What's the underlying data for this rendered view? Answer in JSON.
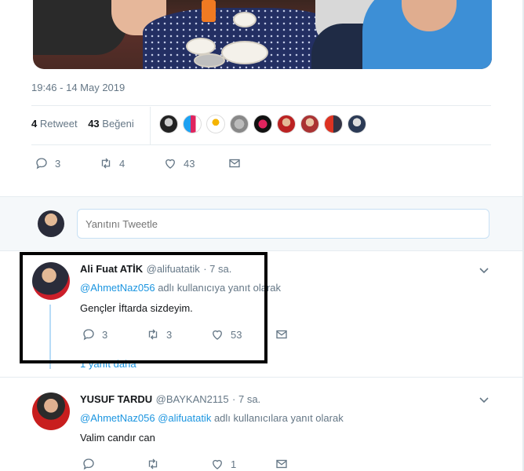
{
  "tweet": {
    "timestamp": "19:46 - 14 May 2019",
    "retweets": {
      "count": "4",
      "label": "Retweet"
    },
    "likes": {
      "count": "43",
      "label": "Beğeni"
    },
    "actions": {
      "reply_count": "3",
      "retweet_count": "4",
      "like_count": "43"
    }
  },
  "reply_box": {
    "placeholder": "Yanıtını Tweetle"
  },
  "replies": [
    {
      "name": "Ali Fuat ATİK",
      "handle": "@alifuatatik",
      "time": "· 7 sa.",
      "replying_to": [
        "@AhmetNaz056"
      ],
      "replying_text": "adlı kullanıcıya yanıt olarak",
      "text": "Gençler İftarda sizdeyim.",
      "reply_count": "3",
      "retweet_count": "3",
      "like_count": "53",
      "more_replies": "1 yanıt daha"
    },
    {
      "name": "YUSUF TARDU",
      "handle": "@BAYKAN2115",
      "time": "· 7 sa.",
      "replying_to": [
        "@AhmetNaz056",
        "@alifuatatik"
      ],
      "replying_text": "adlı kullanıcılara yanıt olarak",
      "text": "Valim candır can",
      "reply_count": "",
      "retweet_count": "",
      "like_count": "1"
    }
  ],
  "colors": {
    "accent": "#1b95e0",
    "muted": "#657786",
    "border": "#e6ecf0",
    "highlight_box": "#000000"
  }
}
